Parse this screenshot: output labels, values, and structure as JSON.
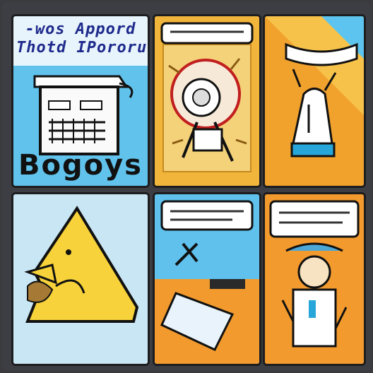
{
  "panel1": {
    "caption_line1": "-wos Appord",
    "caption_line2": "Thotd IPororu",
    "big_text": "Bogoys"
  },
  "colors": {
    "sky": "#5cc4ee",
    "yellow": "#f7d23a",
    "orange": "#f29a2e",
    "outline": "#1d1d1f"
  },
  "icons": [
    "robot-icon",
    "astronaut-icon",
    "rocket-icon",
    "banana-character-icon",
    "speech-bubble-icon"
  ]
}
